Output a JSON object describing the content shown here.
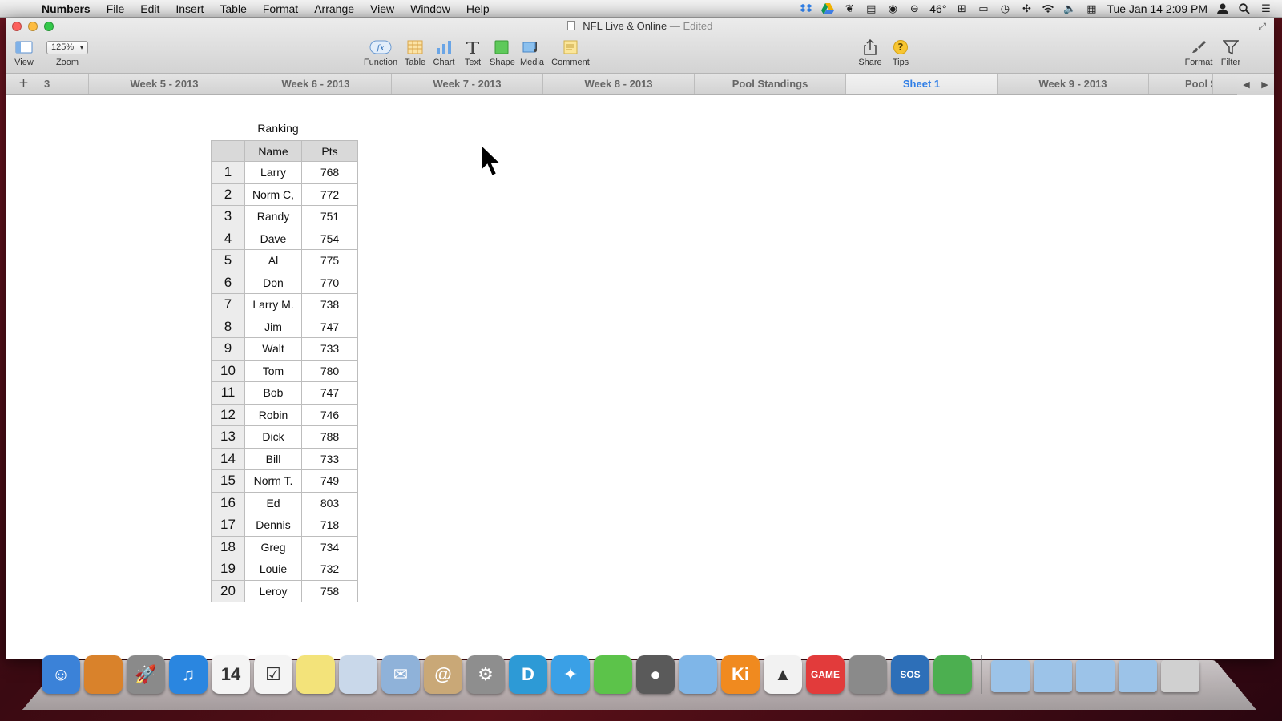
{
  "menubar": {
    "app_name": "Numbers",
    "items": [
      "File",
      "Edit",
      "Insert",
      "Table",
      "Format",
      "Arrange",
      "View",
      "Window",
      "Help"
    ],
    "temperature": "46°",
    "clock": "Tue Jan 14  2:09 PM"
  },
  "window": {
    "title": "NFL Live & Online",
    "edited_suffix": "— Edited"
  },
  "toolbar": {
    "view": "View",
    "zoom_value": "125%",
    "zoom": "Zoom",
    "function": "Function",
    "table": "Table",
    "chart": "Chart",
    "text": "Text",
    "shape": "Shape",
    "media": "Media",
    "comment": "Comment",
    "share": "Share",
    "tips": "Tips",
    "format": "Format",
    "filter": "Filter"
  },
  "sheet_tabs": {
    "items": [
      "3",
      "Week 5 - 2013",
      "Week 6 - 2013",
      "Week 7 - 2013",
      "Week 8 - 2013",
      "Pool Standings",
      "Sheet 1",
      "Week 9 - 2013",
      "Pool S"
    ],
    "active": "Sheet 1"
  },
  "ranking_table": {
    "title": "Ranking",
    "headers": [
      "",
      "Name",
      "Pts"
    ],
    "rows": [
      {
        "rank": "1",
        "name": "Larry",
        "pts": "768"
      },
      {
        "rank": "2",
        "name": "Norm C,",
        "pts": "772"
      },
      {
        "rank": "3",
        "name": "Randy",
        "pts": "751"
      },
      {
        "rank": "4",
        "name": "Dave",
        "pts": "754"
      },
      {
        "rank": "5",
        "name": "Al",
        "pts": "775"
      },
      {
        "rank": "6",
        "name": "Don",
        "pts": "770"
      },
      {
        "rank": "7",
        "name": "Larry M.",
        "pts": "738"
      },
      {
        "rank": "8",
        "name": "Jim",
        "pts": "747"
      },
      {
        "rank": "9",
        "name": "Walt",
        "pts": "733"
      },
      {
        "rank": "10",
        "name": "Tom",
        "pts": "780"
      },
      {
        "rank": "11",
        "name": "Bob",
        "pts": "747"
      },
      {
        "rank": "12",
        "name": "Robin",
        "pts": "746"
      },
      {
        "rank": "13",
        "name": "Dick",
        "pts": "788"
      },
      {
        "rank": "14",
        "name": "Bill",
        "pts": "733"
      },
      {
        "rank": "15",
        "name": "Norm T.",
        "pts": "749"
      },
      {
        "rank": "16",
        "name": "Ed",
        "pts": "803"
      },
      {
        "rank": "17",
        "name": "Dennis",
        "pts": "718"
      },
      {
        "rank": "18",
        "name": "Greg",
        "pts": "734"
      },
      {
        "rank": "19",
        "name": "Louie",
        "pts": "732"
      },
      {
        "rank": "20",
        "name": "Leroy",
        "pts": "758"
      }
    ]
  },
  "dock": {
    "items": [
      {
        "name": "finder-icon",
        "glyph": "☺",
        "color": "#3b82d8"
      },
      {
        "name": "jam-app-icon",
        "glyph": "",
        "color": "#d9822b"
      },
      {
        "name": "launchpad-icon",
        "glyph": "🚀",
        "color": "#8a8a8a"
      },
      {
        "name": "itunes-icon",
        "glyph": "♫",
        "color": "#2a86e0"
      },
      {
        "name": "calendar-icon",
        "glyph": "14",
        "color": "#f4f4f4"
      },
      {
        "name": "reminders-icon",
        "glyph": "☑",
        "color": "#f4f4f4"
      },
      {
        "name": "stickies-icon",
        "glyph": "",
        "color": "#f3e37a"
      },
      {
        "name": "preview-icon",
        "glyph": "",
        "color": "#c9d8ea"
      },
      {
        "name": "mail-icon",
        "glyph": "✉",
        "color": "#8fb2d9"
      },
      {
        "name": "contacts-icon",
        "glyph": "@",
        "color": "#c9a877"
      },
      {
        "name": "system-preferences-icon",
        "glyph": "⚙",
        "color": "#8e8e8e"
      },
      {
        "name": "dashlane-icon",
        "glyph": "D",
        "color": "#2d9ad6"
      },
      {
        "name": "safari-icon",
        "glyph": "✦",
        "color": "#3aa0e6"
      },
      {
        "name": "mindnode-icon",
        "glyph": "",
        "color": "#5cc34a"
      },
      {
        "name": "facetime-icon",
        "glyph": "●",
        "color": "#5a5a5a"
      },
      {
        "name": "numbers-icon",
        "glyph": "",
        "color": "#7fb6e8"
      },
      {
        "name": "keynote-icon",
        "glyph": "Ki",
        "color": "#f08a1f"
      },
      {
        "name": "vector-app-icon",
        "glyph": "▲",
        "color": "#f2f2f2"
      },
      {
        "name": "game-icon",
        "glyph": "GAME",
        "color": "#e23b3b"
      },
      {
        "name": "image-capture-icon",
        "glyph": "",
        "color": "#8a8a8a"
      },
      {
        "name": "sos-icon",
        "glyph": "SOS",
        "color": "#2d6fb8"
      },
      {
        "name": "evernote-icon",
        "glyph": "",
        "color": "#4caf50"
      }
    ],
    "folders": [
      {
        "name": "applications-folder-icon",
        "color": "#9cc3e8"
      },
      {
        "name": "documents-folder-icon",
        "color": "#9cc3e8"
      },
      {
        "name": "downloads-folder-icon",
        "color": "#9cc3e8"
      },
      {
        "name": "folder-icon",
        "color": "#9cc3e8"
      },
      {
        "name": "trash-icon",
        "color": "#d0d0d0"
      }
    ]
  }
}
